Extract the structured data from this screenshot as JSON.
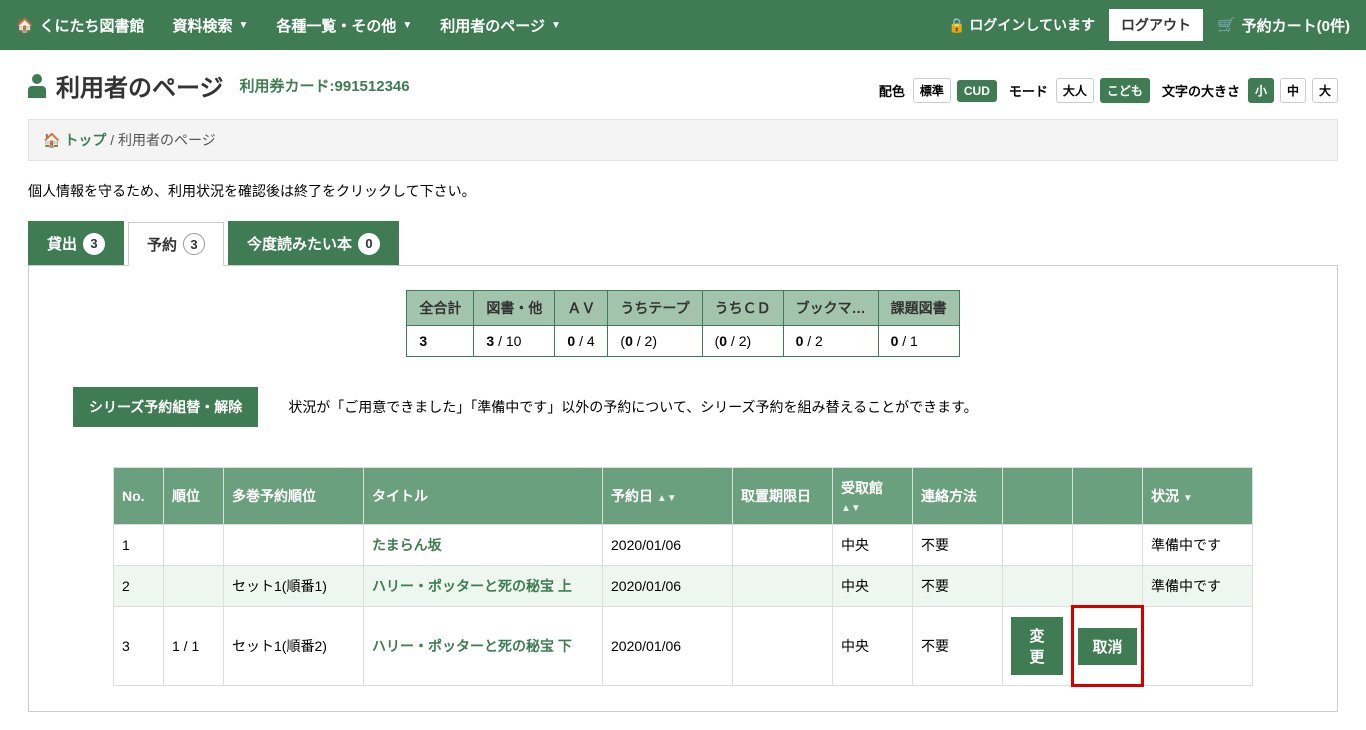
{
  "nav": {
    "brand": "くにたち図書館",
    "items": [
      "資料検索",
      "各種一覧・その他",
      "利用者のページ"
    ],
    "login_status": "ログインしています",
    "logout": "ログアウト",
    "cart": "予約カート(0件)"
  },
  "header": {
    "title": "利用者のページ",
    "card_label": "利用券カード:991512346"
  },
  "display_opts": {
    "color_label": "配色",
    "color_std": "標準",
    "color_cud": "CUD",
    "mode_label": "モード",
    "mode_adult": "大人",
    "mode_child": "こども",
    "size_label": "文字の大きさ",
    "size_s": "小",
    "size_m": "中",
    "size_l": "大"
  },
  "breadcrumb": {
    "top": "トップ",
    "current": "利用者のページ"
  },
  "notice": "個人情報を守るため、利用状況を確認後は終了をクリックして下さい。",
  "tabs": {
    "loan_label": "貸出",
    "loan_count": "3",
    "reserve_label": "予約",
    "reserve_count": "3",
    "wishlist_label": "今度読みたい本",
    "wishlist_count": "0"
  },
  "summary": {
    "headers": [
      "全合計",
      "図書・他",
      "ＡＶ",
      "うちテープ",
      "うちＣＤ",
      "ブックマ…",
      "課題図書"
    ],
    "total": "3",
    "book_cur": "3",
    "book_max": " / 10",
    "av_cur": "0",
    "av_max": " / 4",
    "tape": "(0 / 2)",
    "tape_b": "0",
    "cd": "(0 / 2)",
    "cd_b": "0",
    "bookm_cur": "0",
    "bookm_max": " / 2",
    "kadai_cur": "0",
    "kadai_max": " / 1"
  },
  "series": {
    "button": "シリーズ予約組替・解除",
    "note": "状況が「ご用意できました」「準備中です」以外の予約について、シリーズ予約を組み替えることができます。"
  },
  "table": {
    "headers": {
      "no": "No.",
      "rank": "順位",
      "multi": "多巻予約順位",
      "title": "タイトル",
      "reserve_date": "予約日",
      "pickup_deadline": "取置期限日",
      "pickup_lib": "受取館",
      "contact": "連絡方法",
      "status": "状況"
    },
    "rows": [
      {
        "no": "1",
        "rank": "",
        "multi": "",
        "title": "たまらん坂",
        "date": "2020/01/06",
        "deadline": "",
        "lib": "中央",
        "contact": "不要",
        "change": "",
        "cancel": "",
        "status": "準備中です"
      },
      {
        "no": "2",
        "rank": "",
        "multi": "セット1(順番1)",
        "title": "ハリー・ポッターと死の秘宝  上",
        "date": "2020/01/06",
        "deadline": "",
        "lib": "中央",
        "contact": "不要",
        "change": "",
        "cancel": "",
        "status": "準備中です"
      },
      {
        "no": "3",
        "rank": "1 / 1",
        "multi": "セット1(順番2)",
        "title": "ハリー・ポッターと死の秘宝  下",
        "date": "2020/01/06",
        "deadline": "",
        "lib": "中央",
        "contact": "不要",
        "change": "変更",
        "cancel": "取消",
        "status": ""
      }
    ]
  }
}
